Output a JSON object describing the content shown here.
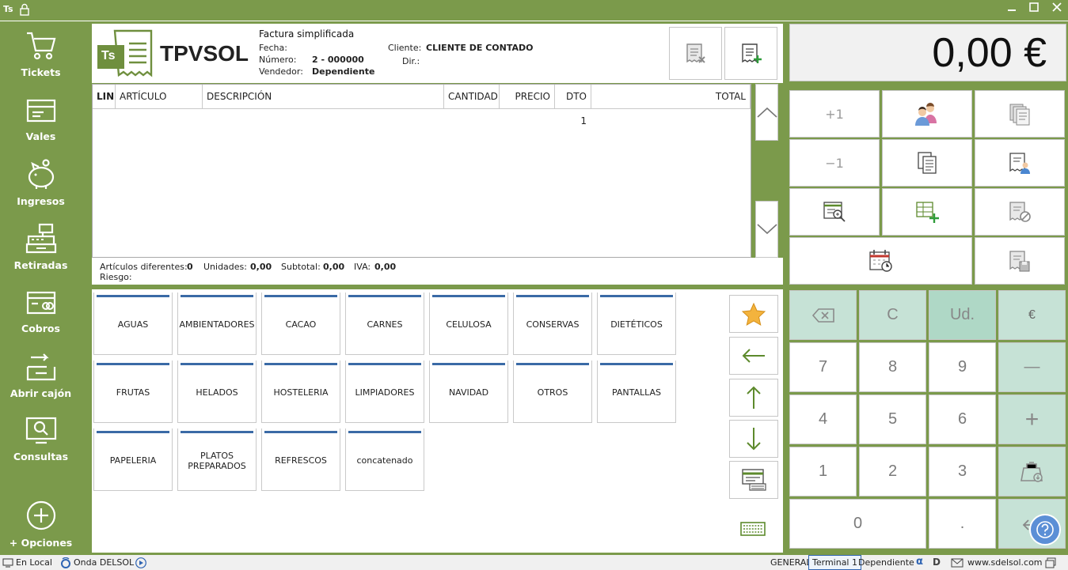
{
  "titlebar": {
    "app_icon": "Ts",
    "minimize": "▁",
    "maximize": "□",
    "close": "✕"
  },
  "sidebar": {
    "items": [
      {
        "label": "Tickets",
        "icon": "cart-icon"
      },
      {
        "label": "Vales",
        "icon": "voucher-icon"
      },
      {
        "label": "Ingresos",
        "icon": "piggy-bank-icon"
      },
      {
        "label": "Retiradas",
        "icon": "cash-register-icon"
      },
      {
        "label": "Cobros",
        "icon": "card-icon"
      },
      {
        "label": "Abrir cajón",
        "icon": "open-drawer-icon"
      },
      {
        "label": "Consultas",
        "icon": "monitor-search-icon"
      },
      {
        "label": "+ Opciones",
        "icon": "plus-circle-icon"
      }
    ]
  },
  "header": {
    "logo_text": "TPVSOL",
    "logo_badge": "Ts",
    "doc_type": "Factura simplificada",
    "fecha_label": "Fecha:",
    "fecha_value": "",
    "numero_label": "Número:",
    "numero_value": "2 - 000000",
    "vendedor_label": "Vendedor:",
    "vendedor_value": "Dependiente",
    "cliente_label": "Cliente:",
    "cliente_value": "CLIENTE DE CONTADO",
    "dir_label": "Dir.:",
    "dir_value": ""
  },
  "grid": {
    "columns": [
      "LIN",
      "ARTÍCULO",
      "DESCRIPCIÓN",
      "CANTIDAD",
      "PRECIO",
      "DTO 1",
      "TOTAL"
    ]
  },
  "summary": {
    "articulos_label": "Artículos diferentes:",
    "articulos_value": "0",
    "unidades_label": "Unidades:",
    "unidades_value": "0,00",
    "subtotal_label": "Subtotal:",
    "subtotal_value": "0,00",
    "iva_label": "IVA:",
    "iva_value": "0,00",
    "riesgo_label": "Riesgo:",
    "riesgo_value": ""
  },
  "families": [
    "AGUAS",
    "AMBIENTADORES",
    "CACAO",
    "CARNES",
    "CELULOSA",
    "CONSERVAS",
    "DIETÉTICOS",
    "FRUTAS",
    "HELADOS",
    "HOSTELERIA",
    "LIMPIADORES",
    "NAVIDAD",
    "OTROS",
    "PANTALLAS",
    "PAPELERIA",
    "PLATOS PREPARADOS",
    "REFRESCOS",
    "concatenado"
  ],
  "total_display": "0,00 €",
  "function_buttons": {
    "plus_one": "+1",
    "minus_one": "−1"
  },
  "keypad": {
    "backspace": "⌫",
    "clear": "C",
    "units": "Ud.",
    "euro": "€",
    "k7": "7",
    "k8": "8",
    "k9": "9",
    "minus": "—",
    "k4": "4",
    "k5": "5",
    "k6": "6",
    "plus": "+",
    "k1": "1",
    "k2": "2",
    "k3": "3",
    "k0": "0",
    "decimal": ".",
    "enter": "↵"
  },
  "statusbar": {
    "local": "En Local",
    "onda": "Onda DELSOL",
    "general": "GENERAL",
    "terminal": "Terminal 1",
    "dependiente": "Dependiente",
    "website": "www.sdelsol.com"
  },
  "colors": {
    "accent_green": "#7b9a4b",
    "family_bar_blue": "#3a6aa6",
    "keypad_green": "#c6e2d6",
    "help_blue": "#5b8fd6"
  }
}
